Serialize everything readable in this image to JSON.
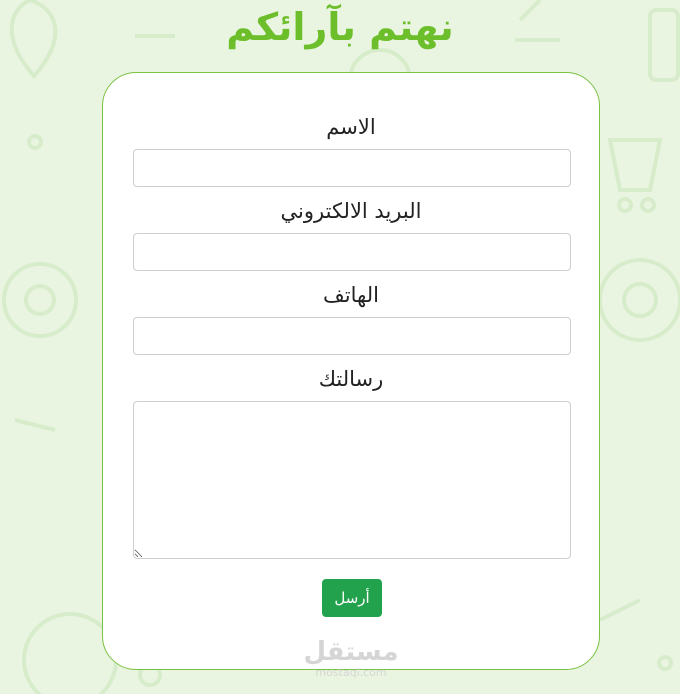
{
  "page": {
    "title": "نهتم بآرائكم"
  },
  "form": {
    "name_label": "الاسم",
    "email_label": "البريد الالكتروني",
    "phone_label": "الهاتف",
    "message_label": "رسالتك",
    "submit_label": "أرسل"
  },
  "watermark": {
    "brand": "مستقل",
    "domain": "mostaql.com"
  },
  "colors": {
    "accent": "#6cbf2a",
    "button": "#23a24d",
    "background": "#eaf5e1",
    "card_border": "#7bc142"
  }
}
